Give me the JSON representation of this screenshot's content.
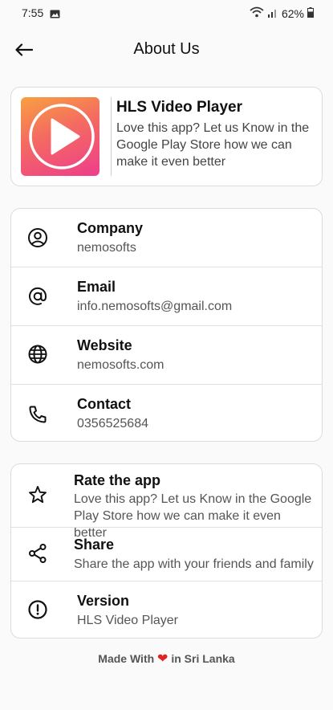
{
  "status_bar": {
    "time": "7:55",
    "battery": "62%"
  },
  "app_bar": {
    "title": "About Us"
  },
  "app_card": {
    "name": "HLS Video Player",
    "description": "Love this app? Let us Know in the Google Play Store how we can make it even better"
  },
  "info": {
    "company": {
      "title": "Company",
      "value": "nemosofts",
      "icon": "account-circle-icon"
    },
    "email": {
      "title": "Email",
      "value": "info.nemosofts@gmail.com",
      "icon": "at-sign-icon"
    },
    "website": {
      "title": "Website",
      "value": "nemosofts.com",
      "icon": "globe-icon"
    },
    "contact": {
      "title": "Contact",
      "value": "0356525684",
      "icon": "phone-icon"
    }
  },
  "actions": {
    "rate": {
      "title": "Rate the app",
      "subtitle": "Love this app? Let us Know in the Google Play Store how we can make it even better",
      "icon": "star-icon"
    },
    "share": {
      "title": "Share",
      "subtitle": "Share the app with your friends and family",
      "icon": "share-icon"
    },
    "version": {
      "title": "Version",
      "subtitle": "HLS Video Player",
      "icon": "info-icon"
    }
  },
  "footer": {
    "prefix": "Made With",
    "heart": "❤",
    "suffix": "in Sri Lanka"
  },
  "colors": {
    "logo_gradient_start": "#f7a040",
    "logo_gradient_end": "#ee3d8a",
    "heart": "#e02424"
  }
}
